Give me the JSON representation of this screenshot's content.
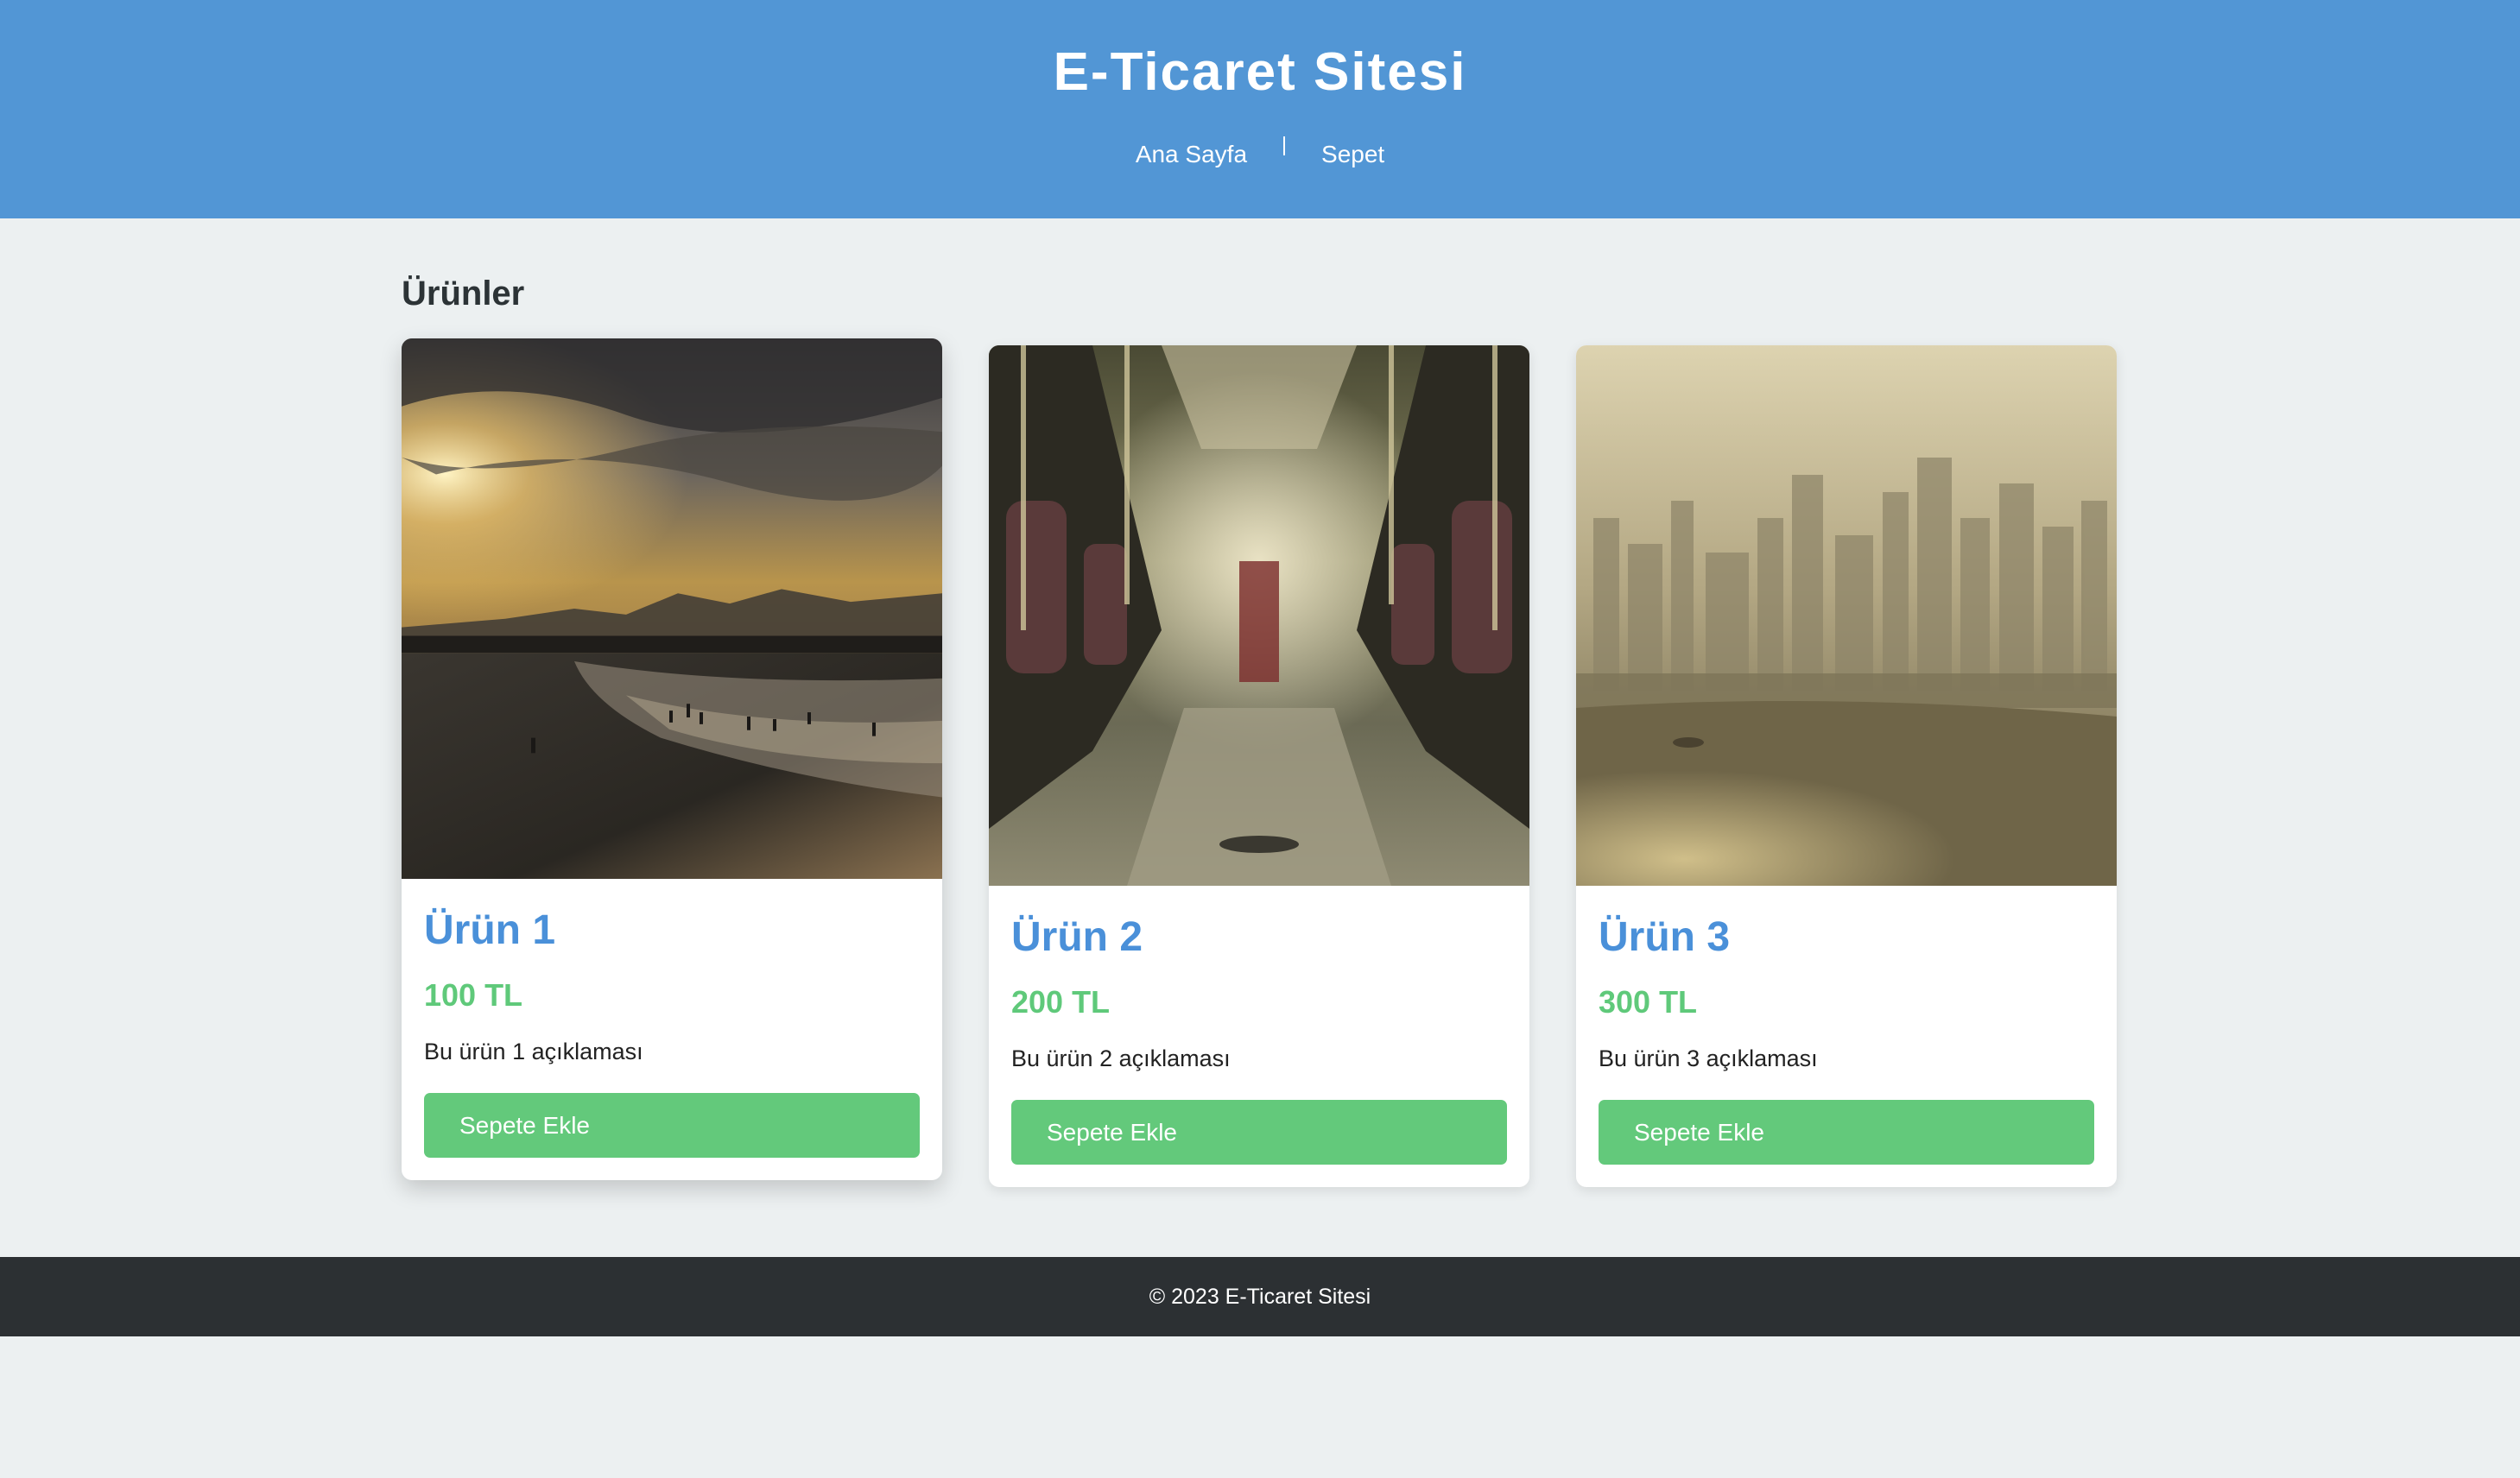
{
  "header": {
    "title": "E-Ticaret Sitesi",
    "nav": [
      {
        "label": "Ana Sayfa"
      },
      {
        "label": "Sepet"
      }
    ]
  },
  "main": {
    "section_title": "Ürünler",
    "products": [
      {
        "name": "Ürün 1",
        "price": "100 TL",
        "description": "Bu ürün 1 açıklaması",
        "button": "Sepete Ekle",
        "image": "beach-sunset-photo"
      },
      {
        "name": "Ürün 2",
        "price": "200 TL",
        "description": "Bu ürün 2 açıklaması",
        "button": "Sepete Ekle",
        "image": "bus-interior-photo"
      },
      {
        "name": "Ürün 3",
        "price": "300 TL",
        "description": "Bu ürün 3 açıklaması",
        "button": "Sepete Ekle",
        "image": "hazy-city-skyline-photo"
      }
    ]
  },
  "footer": {
    "text": "© 2023 E-Ticaret Sitesi"
  },
  "colors": {
    "header_bg": "#5296d5",
    "page_bg": "#ecf0f1",
    "product_name": "#4a90d9",
    "price": "#5fc97a",
    "button_bg": "#63c97b",
    "footer_bg": "#2c3033"
  }
}
